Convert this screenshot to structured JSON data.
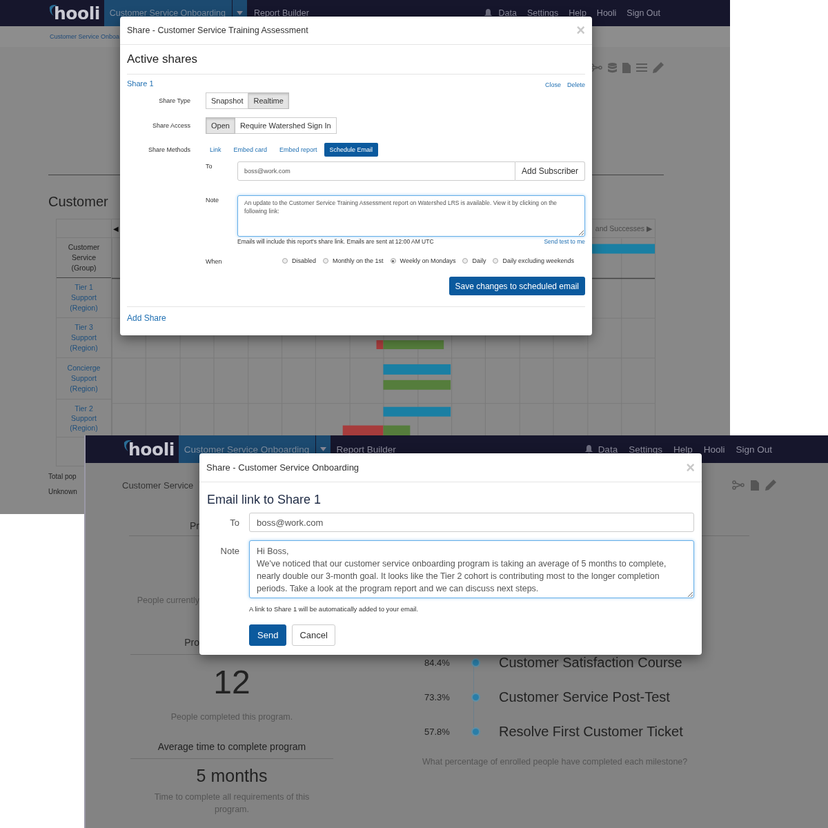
{
  "back_screen": {
    "nav": {
      "logo": "hooli",
      "current": "Customer Service Onboarding",
      "links": [
        "Report Builder"
      ],
      "right": [
        "Data",
        "Settings",
        "Help",
        "Hooli",
        "Sign Out"
      ]
    },
    "breadcrumb": "Customer Service Onboa",
    "heading": "Customer",
    "table": {
      "prev": "◀",
      "legend": "and Successes ▶",
      "corner": "Customer Service (Group)",
      "rows": [
        "Tier 1 Support (Region)",
        "Tier 3 Support (Region)",
        "Concierge Support (Region)",
        "Tier 2 Support (Region)"
      ]
    },
    "notes": [
      "Total pop",
      "Unknown"
    ]
  },
  "share_dialog": {
    "title": "Share - Customer Service Training Assessment",
    "close": "×",
    "heading": "Active shares",
    "share": {
      "name": "Share 1",
      "actions": [
        "Close",
        "Delete"
      ],
      "type": {
        "label": "Share Type",
        "options": [
          {
            "label": "Snapshot",
            "selected": false
          },
          {
            "label": "Realtime",
            "selected": true
          }
        ]
      },
      "access": {
        "label": "Share Access",
        "options": [
          {
            "label": "Open",
            "selected": true
          },
          {
            "label": "Require Watershed Sign In",
            "selected": false
          }
        ]
      },
      "methods": {
        "label": "Share Methods",
        "options": [
          {
            "label": "Link",
            "selected": false
          },
          {
            "label": "Embed card",
            "selected": false
          },
          {
            "label": "Embed report",
            "selected": false
          },
          {
            "label": "Schedule Email",
            "selected": true
          }
        ]
      },
      "to": {
        "label": "To",
        "value": "boss@work.com",
        "button": "Add Subscriber"
      },
      "note": {
        "label": "Note",
        "value": "An update to the Customer Service Training Assessment report on Watershed LRS is available. View it by clicking on the following link:"
      },
      "hint": "Emails will include this report's share link. Emails are sent at 12:00 AM UTC",
      "test_link": "Send test to me",
      "when": {
        "label": "When",
        "options": [
          {
            "label": "Disabled",
            "selected": false
          },
          {
            "label": "Monthly on the 1st",
            "selected": false
          },
          {
            "label": "Weekly on Mondays",
            "selected": true
          },
          {
            "label": "Daily",
            "selected": false
          },
          {
            "label": "Daily excluding weekends",
            "selected": false
          }
        ]
      },
      "save": "Save changes to scheduled email"
    },
    "add_share": "Add Share"
  },
  "front_screen": {
    "nav": {
      "logo": "hooli",
      "current": "Customer Service Onboarding",
      "links": [
        "Report Builder"
      ],
      "right": [
        "Data",
        "Settings",
        "Help",
        "Hooli",
        "Sign Out"
      ]
    },
    "breadcrumb": "Customer Service",
    "section_title": "Pr",
    "enrolled_caption": "People currently",
    "completed_title": "Pro",
    "completed": {
      "value": "12",
      "caption": "People completed this program."
    },
    "average": {
      "title": "Average time to complete program",
      "value": "5 months",
      "caption": "Time to complete all requirements of this program."
    },
    "milestones": [
      {
        "percent": "84.4%",
        "name": "Customer Satisfaction Course"
      },
      {
        "percent": "73.3%",
        "name": "Customer Service Post-Test"
      },
      {
        "percent": "57.8%",
        "name": "Resolve First Customer Ticket"
      }
    ],
    "question": "What percentage of enrolled people have completed each milestone?"
  },
  "email_dialog": {
    "title": "Share - Customer Service Onboarding",
    "close": "×",
    "heading": "Email link to Share 1",
    "to": {
      "label": "To",
      "value": "boss@work.com"
    },
    "note": {
      "label": "Note",
      "value": "Hi Boss,\nWe've noticed that our customer service onboarding program is taking an average of 5 months to complete, nearly double our 3-month goal. It looks like the Tier 2 cohort is contributing most to the longer completion periods. Take a look at the program report and we can discuss next steps."
    },
    "hint": "A link to Share 1 will be automatically added to your email.",
    "send": "Send",
    "cancel": "Cancel"
  }
}
